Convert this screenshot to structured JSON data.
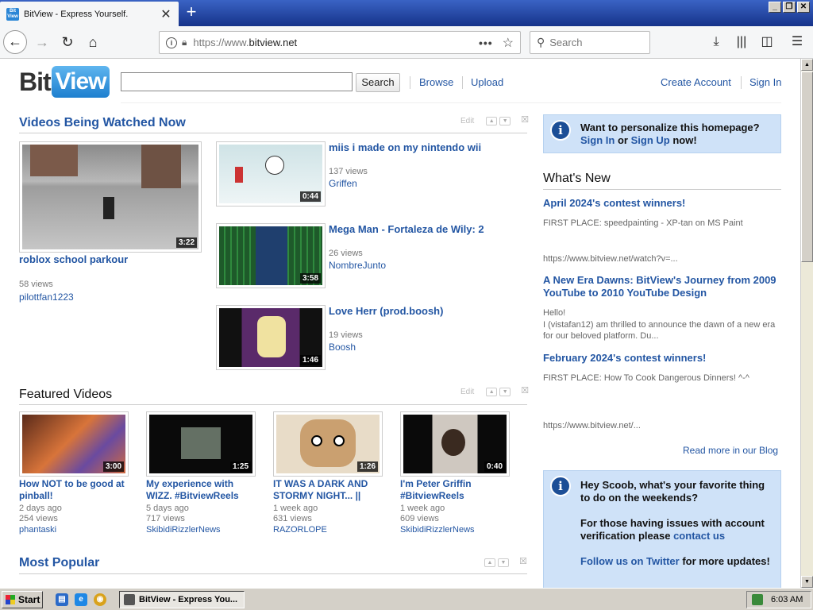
{
  "browser": {
    "tab_title": "BitView - Express Yourself.",
    "favicon_text": "Bit View",
    "new_tab": "+",
    "url_scheme": "https://www.",
    "url_host": "bitview.net",
    "search_placeholder": "Search"
  },
  "site": {
    "logo_bit": "Bit",
    "logo_view": "View",
    "search_button": "Search",
    "nav": {
      "browse": "Browse",
      "upload": "Upload",
      "create_account": "Create Account",
      "sign_in": "Sign In"
    }
  },
  "watched_now": {
    "title": "Videos Being Watched Now",
    "edit": "Edit",
    "featured": {
      "title": "roblox school parkour",
      "views": "58 views",
      "user": "pilottfan1223",
      "duration": "3:22"
    },
    "items": [
      {
        "title": "miis i made on my nintendo wii",
        "views": "137 views",
        "user": "Griffen",
        "duration": "0:44"
      },
      {
        "title": "Mega Man - Fortaleza de Wily: 2",
        "views": "26 views",
        "user": "NombreJunto",
        "duration": "3:58"
      },
      {
        "title": "Love Herr (prod.boosh)",
        "views": "19 views",
        "user": "Boosh",
        "duration": "1:46"
      }
    ]
  },
  "featured_videos": {
    "title": "Featured Videos",
    "edit": "Edit",
    "items": [
      {
        "title": "How NOT to be good at pinball!",
        "ago": "2 days ago",
        "views": "254 views",
        "user": "phantaski",
        "duration": "3:00"
      },
      {
        "title": "My experience with WIZZ. #BitviewReels",
        "ago": "5 days ago",
        "views": "717 views",
        "user": "SkibidiRizzlerNews",
        "duration": "1:25"
      },
      {
        "title": "IT WAS A DARK AND STORMY NIGHT... ||",
        "ago": "1 week ago",
        "views": "631 views",
        "user": "RAZORLOPE",
        "duration": "1:26"
      },
      {
        "title": "I'm Peter Griffin #BitviewReels",
        "ago": "1 week ago",
        "views": "609 views",
        "user": "SkibidiRizzlerNews",
        "duration": "0:40"
      }
    ]
  },
  "most_popular": {
    "title": "Most Popular"
  },
  "sidebar": {
    "personalize": {
      "text": "Want to personalize this homepage?",
      "sign_in": "Sign In",
      "or": "or",
      "sign_up": "Sign Up",
      "now": "now!"
    },
    "whats_new_title": "What's New",
    "posts": [
      {
        "title": "April 2024's contest winners!",
        "text": "FIRST PLACE: speedpainting - XP-tan on MS Paint",
        "link": "https://www.bitview.net/watch?v=..."
      },
      {
        "title": "A New Era Dawns: BitView's Journey from 2009 YouTube to 2010 YouTube Design",
        "text1": "Hello!",
        "text2": "I (vistafan12) am thrilled to announce the dawn of a new era for our beloved platform. Du..."
      },
      {
        "title": "February 2024's contest winners!",
        "text": "FIRST PLACE: How To Cook Dangerous Dinners! ^-^",
        "link": "https://www.bitview.net/..."
      }
    ],
    "read_more": "Read more in our Blog",
    "scoob": {
      "line1": "Hey Scoob, what's your favorite thing to do on the weekends?",
      "line2": "For those having issues with account verification please",
      "contact": "contact us",
      "follow": "Follow us on Twitter",
      "follow_rest": "for more updates!"
    }
  },
  "taskbar": {
    "start": "Start",
    "task_title": "BitView - Express You...",
    "clock": "6:03 AM"
  }
}
